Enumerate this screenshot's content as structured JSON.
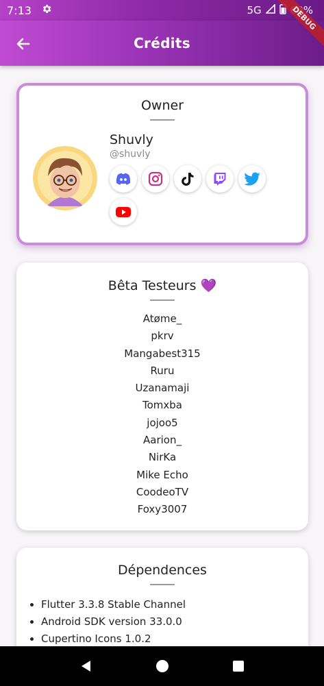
{
  "status_bar": {
    "time": "7:13",
    "network": "5G",
    "battery": "69%",
    "icons": [
      "gear-icon",
      "signal-icon",
      "battery-icon"
    ]
  },
  "app_bar": {
    "title": "Crédits",
    "back_icon": "arrow-left-icon"
  },
  "debug_banner": "DEBUG",
  "owner": {
    "section_title": "Owner",
    "name": "Shuvly",
    "handle": "@shuvly",
    "socials": [
      "discord",
      "instagram",
      "tiktok",
      "twitch",
      "twitter",
      "youtube"
    ]
  },
  "beta": {
    "section_title": "Bêta Testeurs 💜",
    "testers": [
      "Atøme_",
      "pkrv",
      "Mangabest315",
      "Ruru",
      "Uzanamaji",
      "Tomxba",
      "jojoo5",
      "Aarion_",
      "NirKa",
      "Mike Echo",
      "CoodeoTV",
      "Foxy3007"
    ]
  },
  "dependencies": {
    "section_title": "Dépendences",
    "items": [
      "Flutter 3.3.8 Stable Channel",
      "Android SDK version 33.0.0",
      "Cupertino Icons 1.0.2"
    ]
  },
  "colors": {
    "accent": "#9a33b5",
    "accent_light": "#c88dd6",
    "discord": "#5865f2",
    "instagram": "#c13584",
    "twitch": "#9146ff",
    "twitter": "#1da1f2",
    "youtube": "#ff0000"
  }
}
